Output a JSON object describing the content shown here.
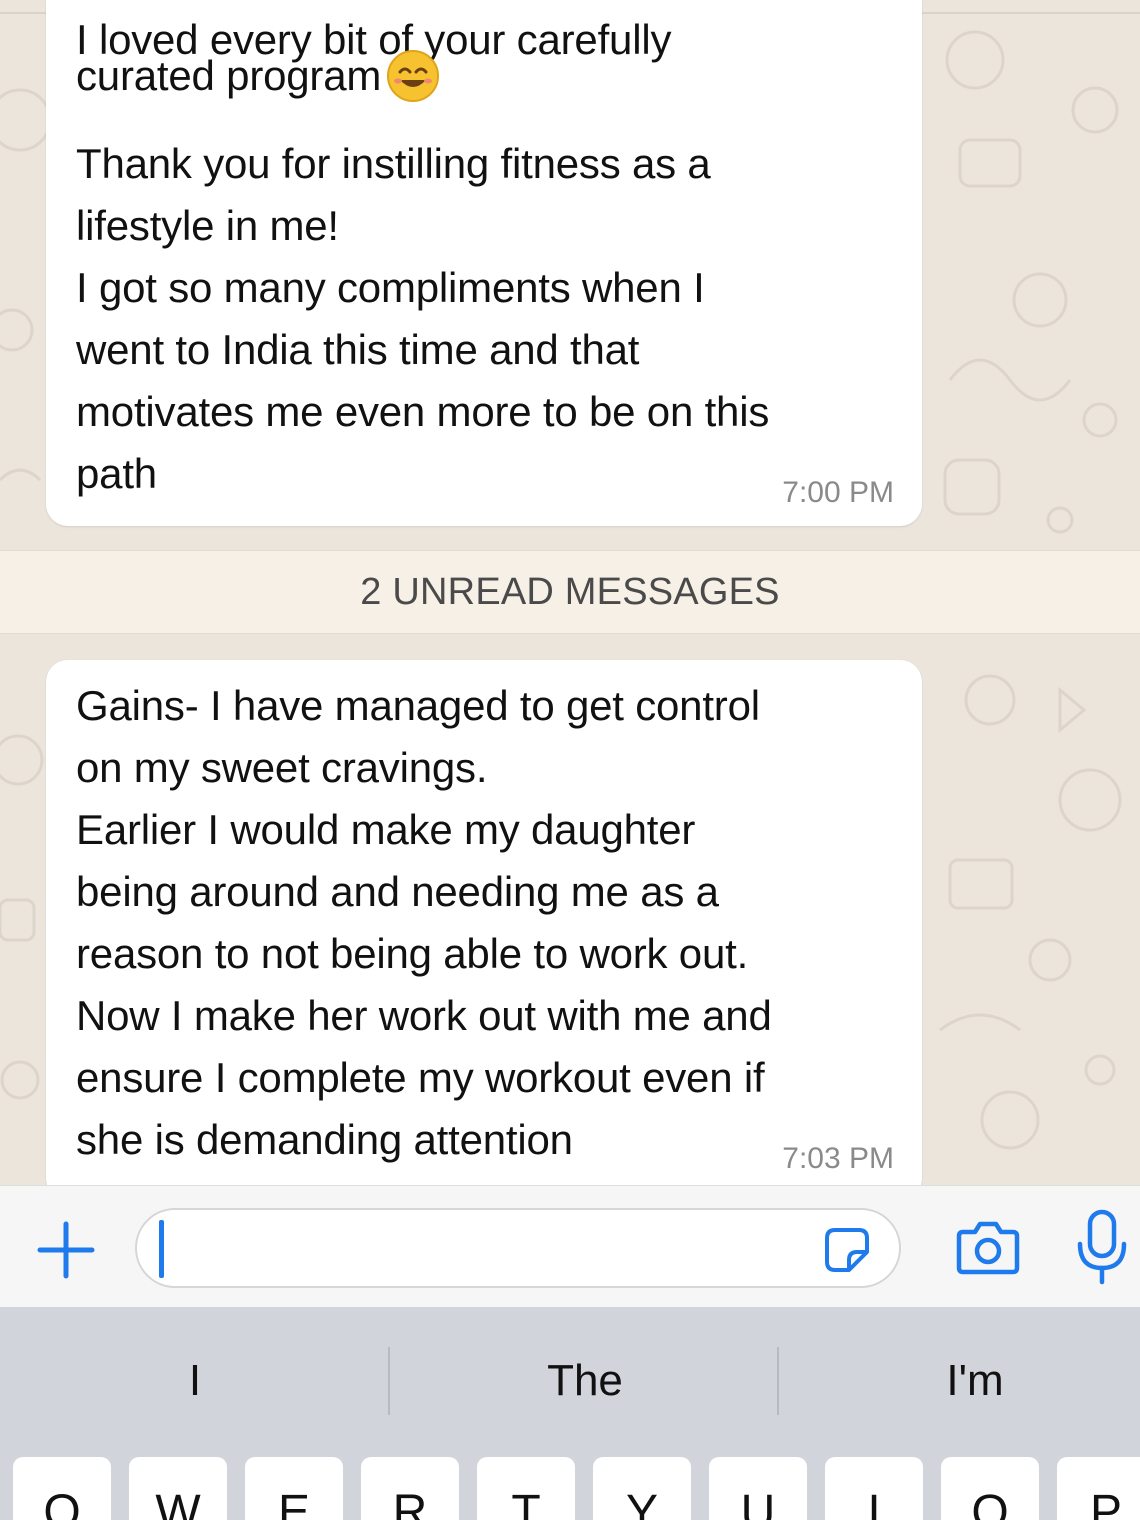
{
  "messages": [
    {
      "lines": [
        "I loved every bit of your carefully",
        "curated program",
        "Thank you for instilling fitness as a",
        "lifestyle in me!",
        "I got so many compliments when I",
        "went to India this time and that",
        "motivates me even more to be on this",
        "path"
      ],
      "emoji": "smiling-face-emoji",
      "time": "7:00 PM"
    },
    {
      "lines": [
        "Gains- I have managed to get control",
        "on my sweet cravings.",
        "Earlier I would make my daughter",
        "being around and needing me as a",
        "reason to not being able to work out.",
        "Now I make her work out with me and",
        "ensure I complete my workout even if",
        "she is demanding attention"
      ],
      "time": "7:03 PM"
    }
  ],
  "unread_banner": "2 UNREAD MESSAGES",
  "input_bar": {
    "plus_icon": "plus-icon",
    "text_value": "",
    "sticker_icon": "sticker-icon",
    "camera_icon": "camera-icon",
    "mic_icon": "microphone-icon"
  },
  "keyboard": {
    "suggestions": [
      "I",
      "The",
      "I'm"
    ],
    "top_row_keys": [
      "Q",
      "W",
      "E",
      "R",
      "T",
      "Y",
      "U",
      "I",
      "O",
      "P"
    ]
  },
  "colors": {
    "accent": "#1f7aec",
    "chat_background": "#ece5dc",
    "bubble": "#ffffff",
    "banner": "#f6f0e6",
    "keyboard": "#d1d4da"
  }
}
